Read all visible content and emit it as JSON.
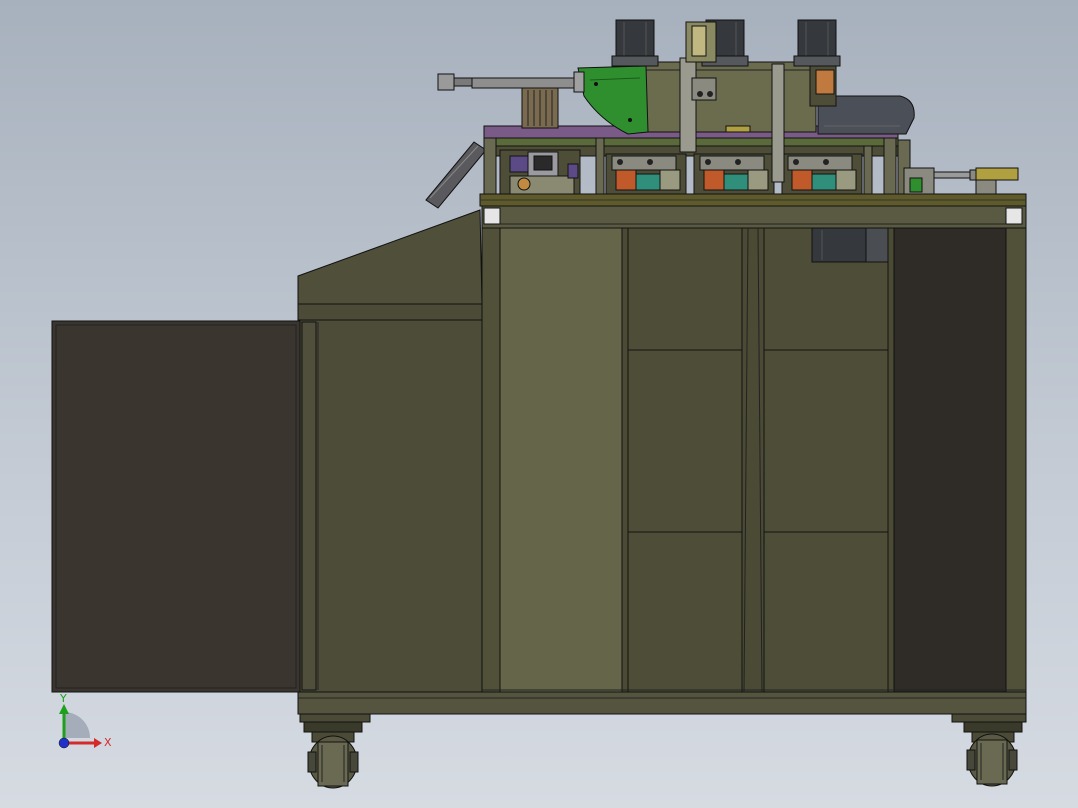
{
  "viewport": {
    "background_top": "#a7b1bd",
    "background_bottom": "#d6dbe2"
  },
  "model": {
    "body_color": "#4e4e38",
    "body_light_color": "#65654a",
    "dark_panel_color": "#2f2c27",
    "gray_part_color": "#4b4f58",
    "green_part_color": "#2f8f2f",
    "purple_part_color": "#7a5a86",
    "motor_color": "#35383c"
  },
  "triad": {
    "x_label": "X",
    "y_label": "Y",
    "x_color": "#d42a2a",
    "y_color": "#1ea01e",
    "z_color": "#2030c8"
  }
}
